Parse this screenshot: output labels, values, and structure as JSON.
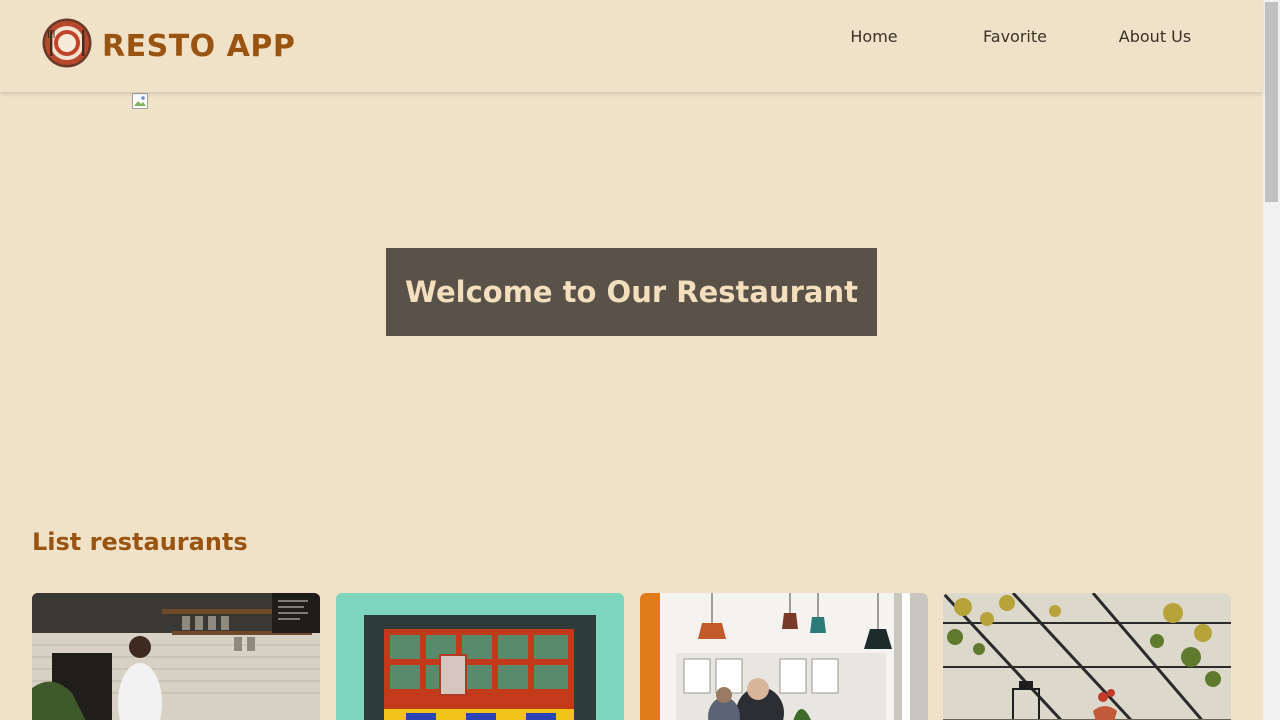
{
  "header": {
    "brand": "RESTO APP",
    "logo_icon": "restaurant-plate-icon",
    "nav": [
      {
        "label": "Home"
      },
      {
        "label": "Favorite"
      },
      {
        "label": "About Us"
      }
    ]
  },
  "hero": {
    "title": "Welcome to Our Restaurant",
    "image_icon": "broken-image-icon"
  },
  "restaurants": {
    "heading": "List restaurants",
    "cards": [
      {
        "image": "cafe-barista-counter-photo"
      },
      {
        "image": "turquoise-storefront-photo"
      },
      {
        "image": "cafe-pendant-lamps-photo"
      },
      {
        "image": "greenhouse-cafe-table-photo"
      }
    ]
  },
  "colors": {
    "background": "#f0e2c8",
    "brand": "#9a5412",
    "banner": "#5a5248",
    "banner_text": "#f3dfbd"
  }
}
